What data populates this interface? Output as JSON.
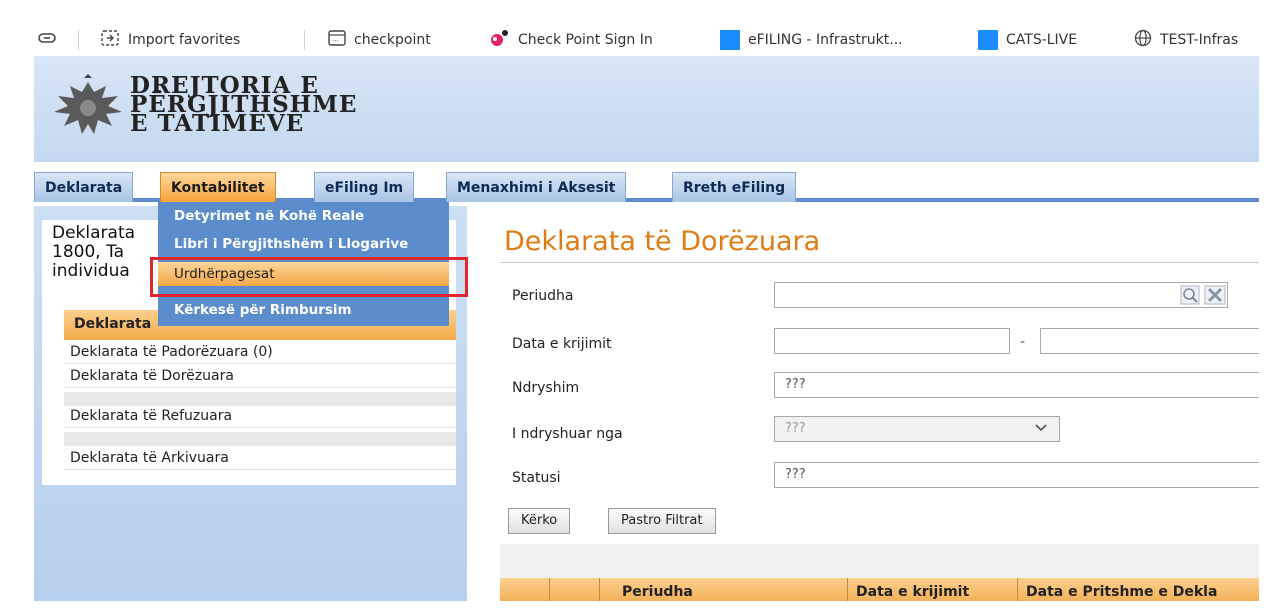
{
  "favorites": [
    {
      "label": "",
      "icon": "tab-icon"
    },
    {
      "label": "Import favorites",
      "icon": "import-icon"
    },
    {
      "label": "checkpoint",
      "icon": "page-icon"
    },
    {
      "label": "Check Point Sign In",
      "icon": "checkpoint-icon"
    },
    {
      "label": "eFILING - Infrastrukt...",
      "icon": "blue-square-icon"
    },
    {
      "label": "CATS-LIVE",
      "icon": "blue-square-icon"
    },
    {
      "label": "TEST-Infras",
      "icon": "globe-icon"
    }
  ],
  "header": {
    "logo_line1": "DREJTORIA E",
    "logo_line2": "PËRGJITHSHME",
    "logo_line3": "E TATIMEVE"
  },
  "tabs": [
    "Deklarata",
    "Kontabilitet",
    "eFiling Im",
    "Menaxhimi i Aksesit",
    "Rreth eFiling"
  ],
  "active_tab": "Kontabilitet",
  "dropdown": {
    "items": [
      "Detyrimet në Kohë Reale",
      "Libri i Përgjithshëm i Llogarive",
      "Urdhërpagesat",
      "Kërkesë për Rimbursim"
    ],
    "highlighted": "Urdhërpagesat"
  },
  "left_panel": {
    "intro_line1": "Deklarata",
    "intro_line2": "1800, Ta",
    "intro_line3": "individua",
    "section_title": "Deklarata",
    "items": [
      "Deklarata të Padorëzuara (0)",
      "Deklarata të Dorëzuara",
      "Deklarata të Refuzuara",
      "Deklarata të Arkivuara"
    ]
  },
  "main": {
    "title": "Deklarata të Dorëzuara",
    "fields": {
      "period_label": "Periudha",
      "period_value": "",
      "created_label": "Data e krijimit",
      "created_from": "",
      "created_to": "",
      "range_separator": "-",
      "change_label": "Ndryshim",
      "change_value": "???",
      "changed_by_label": "I ndryshuar nga",
      "changed_by_value": "???",
      "status_label": "Statusi",
      "status_value": "???"
    },
    "buttons": {
      "search": "Kërko",
      "clear": "Pastro Filtrat"
    },
    "table_headers": [
      "",
      "",
      "Periudha",
      "Data e krijimit",
      "Data e Pritshme e Dekla"
    ]
  },
  "colors": {
    "accent_orange": "#e07b12",
    "menu_blue": "#5b8dcc",
    "highlight_red": "#e0262c"
  }
}
